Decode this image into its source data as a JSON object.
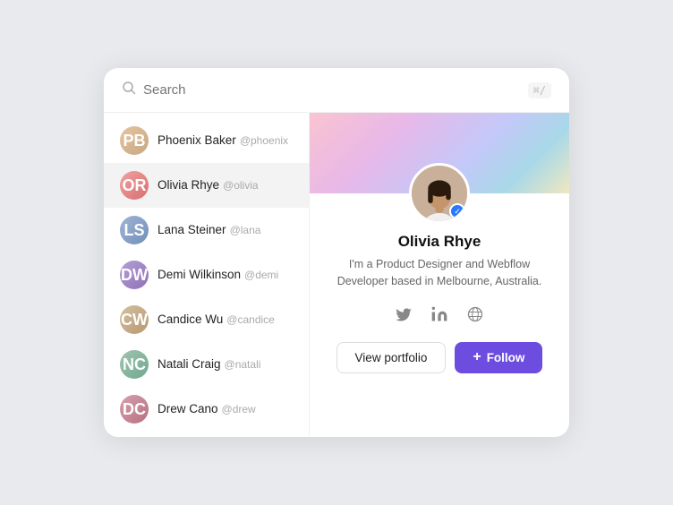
{
  "search": {
    "placeholder": "Search",
    "shortcut": "⌘/"
  },
  "users": [
    {
      "id": 1,
      "name": "Phoenix Baker",
      "handle": "@phoenix",
      "initials": "PB",
      "colorClass": "av-1",
      "active": false
    },
    {
      "id": 2,
      "name": "Olivia Rhye",
      "handle": "@olivia",
      "initials": "OR",
      "colorClass": "av-2",
      "active": true
    },
    {
      "id": 3,
      "name": "Lana Steiner",
      "handle": "@lana",
      "initials": "LS",
      "colorClass": "av-3",
      "active": false
    },
    {
      "id": 4,
      "name": "Demi Wilkinson",
      "handle": "@demi",
      "initials": "DW",
      "colorClass": "av-4",
      "active": false
    },
    {
      "id": 5,
      "name": "Candice Wu",
      "handle": "@candice",
      "initials": "CW",
      "colorClass": "av-5",
      "active": false
    },
    {
      "id": 6,
      "name": "Natali Craig",
      "handle": "@natali",
      "initials": "NC",
      "colorClass": "av-6",
      "active": false
    },
    {
      "id": 7,
      "name": "Drew Cano",
      "handle": "@drew",
      "initials": "DC",
      "colorClass": "av-7",
      "active": false
    }
  ],
  "profile": {
    "name": "Olivia Rhye",
    "bio": "I'm a Product Designer and Webflow\nDeveloper based in Melbourne, Australia.",
    "verified": true,
    "view_portfolio_label": "View portfolio",
    "follow_label": "Follow",
    "social": {
      "twitter_title": "Twitter",
      "linkedin_title": "LinkedIn",
      "dribbble_title": "Dribbble"
    }
  }
}
